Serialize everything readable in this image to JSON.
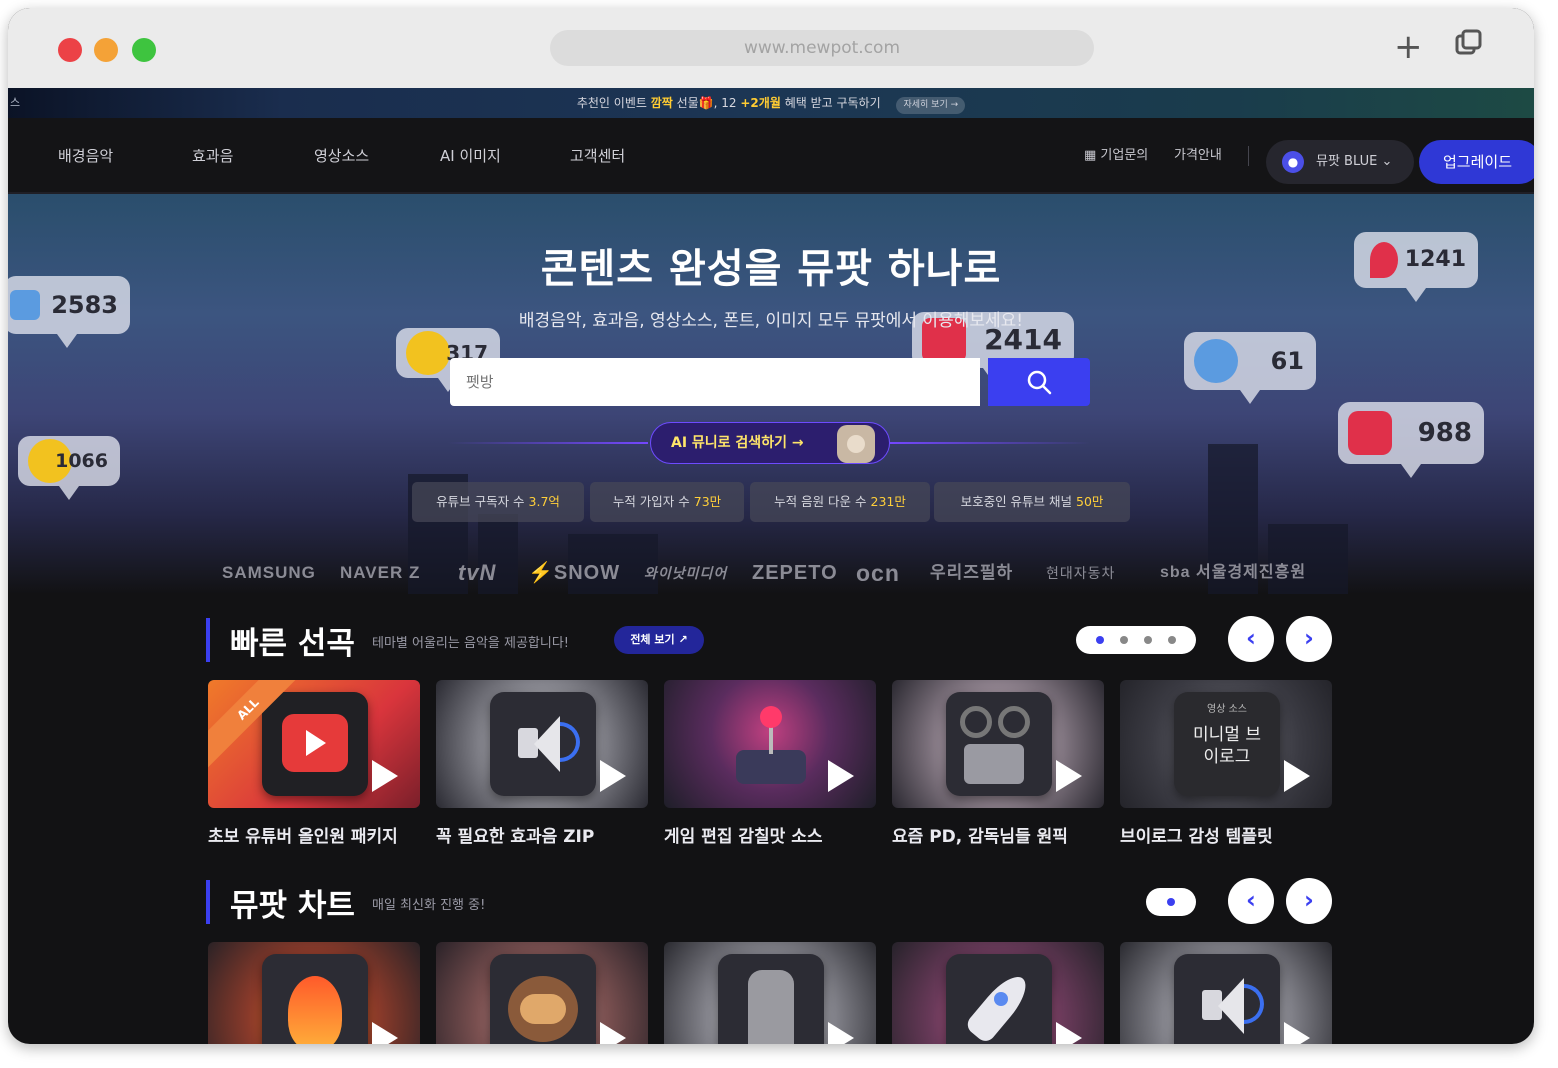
{
  "browser": {
    "url": "www.mewpot.com",
    "traffic_colors": [
      "#ec4246",
      "#f4a237",
      "#3ec43f"
    ]
  },
  "promo": {
    "left_text": "스",
    "parts": [
      "추천인 이벤트 ",
      "깜짝",
      " 선물🎁, 12 ",
      "+2개월",
      " 혜택 받고 구독하기"
    ],
    "more_label": "자세히 보기 →"
  },
  "nav": {
    "items": [
      "배경음악",
      "효과음",
      "영상소스",
      "AI 이미지",
      "고객센터"
    ],
    "business": "기업문의",
    "pricing": "가격안내",
    "account_label": "뮤팟 BLUE",
    "upgrade_label": "업그레이드"
  },
  "hero": {
    "title": "콘텐츠 완성을 뮤팟 하나로",
    "subtitle": "배경음악, 효과음, 영상소스, 폰트, 이미지 모두 뮤팟에서 이용해보세요!",
    "search_placeholder": "펫방",
    "ai_button": "AI 뮤니로 검색하기 →",
    "bubbles": [
      "2583",
      "317",
      "2414",
      "1241",
      "61",
      "1066",
      "988"
    ],
    "stats": [
      {
        "label": "유튜브 구독자 수 ",
        "value": "3.7억"
      },
      {
        "label": "누적 가입자 수 ",
        "value": "73만"
      },
      {
        "label": "누적 음원 다운 수 ",
        "value": "231만"
      },
      {
        "label": "보호중인 유튜브 채널 ",
        "value": "50만"
      }
    ]
  },
  "partners": [
    "SAMSUNG",
    "NAVER Z",
    "tvN",
    "⚡SNOW",
    "와이낫미디어",
    "ZEPETO",
    "ocn",
    "우리즈필하",
    "현대자동차",
    "sba 서울경제진흥원"
  ],
  "section_quick": {
    "title": "빠른 선곡",
    "subtitle": "테마별 어울리는 음악을 제공합니다!",
    "all_label": "전체 보기 ↗",
    "cards": [
      {
        "title": "초보 유튜버 올인원 패키지",
        "badge": "ALL",
        "icon": "play-icon"
      },
      {
        "title": "꼭 필요한 효과음 ZIP",
        "icon": "speaker-icon"
      },
      {
        "title": "게임 편집 감칠맛 소스",
        "icon": "joystick-icon"
      },
      {
        "title": "요즘 PD, 감독님들 원픽",
        "icon": "camera-icon"
      },
      {
        "title": "브이로그 감성 템플릿",
        "icon": "text-card-icon",
        "card_text": "미니멀 브이로그",
        "card_tag": "영상 소스"
      }
    ]
  },
  "section_chart": {
    "title": "뮤팟 차트",
    "subtitle": "매일 최신화 진행 중!",
    "cards": [
      {
        "icon": "fire-icon"
      },
      {
        "icon": "monkey-icon"
      },
      {
        "icon": "moai-icon"
      },
      {
        "icon": "rocket-icon"
      },
      {
        "icon": "speaker-icon"
      }
    ]
  },
  "colors": {
    "accent": "#3b3ff0",
    "highlight_yellow": "#ffcc33",
    "background": "#121214"
  }
}
